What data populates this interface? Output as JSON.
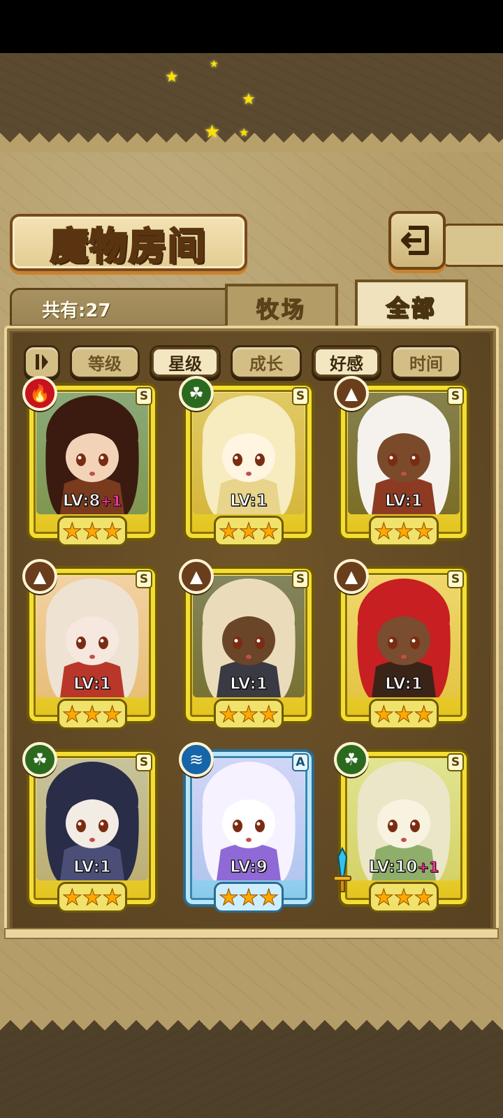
{
  "header": {
    "title": "魔物房间",
    "count_label": "共有:27"
  },
  "tabs": [
    {
      "label": "牧场",
      "active": false
    },
    {
      "label": "全部",
      "active": true
    }
  ],
  "filters": [
    {
      "label": "等级",
      "active": false
    },
    {
      "label": "星级",
      "active": true
    },
    {
      "label": "成长",
      "active": false
    },
    {
      "label": "好感",
      "active": true
    },
    {
      "label": "时间",
      "active": false
    }
  ],
  "monsters": [
    {
      "level": "LV:8",
      "bonus": "+1",
      "rank": "S",
      "element": "fire",
      "element_icon": "flame-icon",
      "frame": "gold",
      "stars": 3,
      "palette": [
        "#3b1a10",
        "#7a3a1e",
        "#f3d3b8",
        "#2b6d70"
      ]
    },
    {
      "level": "LV:1",
      "bonus": "",
      "rank": "S",
      "element": "wind",
      "element_icon": "leaf-icon",
      "frame": "gold",
      "stars": 3,
      "palette": [
        "#f6ecc0",
        "#e8d48a",
        "#fff5e0",
        "#c9a84a"
      ]
    },
    {
      "level": "LV:1",
      "bonus": "",
      "rank": "S",
      "element": "earth",
      "element_icon": "mountain-icon",
      "frame": "gold",
      "stars": 3,
      "palette": [
        "#f5f2ee",
        "#8c3b22",
        "#7a4a2a",
        "#222222"
      ]
    },
    {
      "level": "LV:1",
      "bonus": "",
      "rank": "S",
      "element": "earth",
      "element_icon": "mountain-icon",
      "frame": "gold",
      "stars": 3,
      "palette": [
        "#eee2d2",
        "#b9372a",
        "#f6e8de",
        "#e9b7b9"
      ]
    },
    {
      "level": "LV:1",
      "bonus": "",
      "rank": "S",
      "element": "earth",
      "element_icon": "mountain-icon",
      "frame": "gold",
      "stars": 3,
      "palette": [
        "#eadcbb",
        "#3a3a44",
        "#6b4528",
        "#1d2a3a"
      ]
    },
    {
      "level": "LV:1",
      "bonus": "",
      "rank": "S",
      "element": "earth",
      "element_icon": "mountain-icon",
      "frame": "gold",
      "stars": 3,
      "palette": [
        "#c71f22",
        "#3a2418",
        "#7a4c30",
        "#e4c15a"
      ]
    },
    {
      "level": "LV:1",
      "bonus": "",
      "rank": "S",
      "element": "wind",
      "element_icon": "leaf-icon",
      "frame": "gold",
      "stars": 3,
      "palette": [
        "#2a2d48",
        "#4b4f78",
        "#f3ece4",
        "#9a9ab0"
      ]
    },
    {
      "level": "LV:9",
      "bonus": "",
      "rank": "A",
      "element": "water",
      "element_icon": "wave-icon",
      "frame": "blue",
      "stars": 3,
      "palette": [
        "#f6f2ff",
        "#8f6ad6",
        "#ffffff",
        "#cfc0f0"
      ]
    },
    {
      "level": "LV:10",
      "bonus": "+1",
      "rank": "S",
      "element": "wind",
      "element_icon": "leaf-icon",
      "frame": "gold",
      "stars": 3,
      "palette": [
        "#ece6c8",
        "#8fae6a",
        "#f8f3e0",
        "#c7d99a"
      ],
      "weapon": "sword-icon"
    }
  ]
}
